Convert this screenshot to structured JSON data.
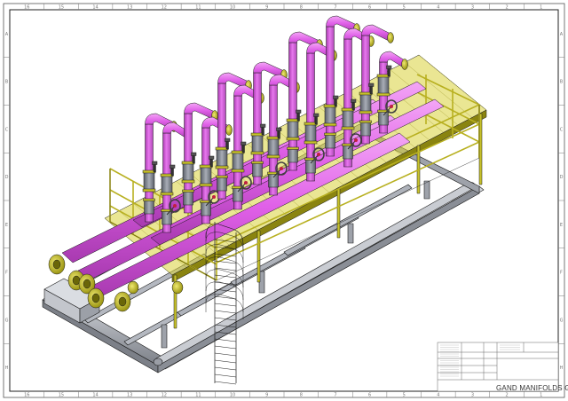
{
  "drawing": {
    "title_block": {
      "title": "GAND MANIFOLDS GOOPS"
    },
    "border": {
      "top_zones": [
        "16",
        "15",
        "14",
        "13",
        "12",
        "11",
        "10",
        "9",
        "8",
        "7",
        "6",
        "5",
        "4",
        "3",
        "2",
        "1"
      ],
      "bottom_zones": [
        "16",
        "15",
        "14",
        "13",
        "12",
        "11",
        "10",
        "9",
        "8",
        "7",
        "6",
        "5",
        "4",
        "3",
        "2",
        "1"
      ],
      "left_zones": [
        "A",
        "B",
        "C",
        "D",
        "E",
        "F",
        "G",
        "H"
      ],
      "right_zones": [
        "A",
        "B",
        "C",
        "D",
        "E",
        "F",
        "G",
        "H"
      ]
    },
    "colors": {
      "pipe": "#e060e8",
      "pipe_dark": "#a83ab0",
      "structure": "#c8c22a",
      "structure_dark": "#8a8410",
      "skid": "#b8bcc4",
      "skid_dark": "#6c7078",
      "valve": "#7a7f88",
      "handwheel": "#c02040",
      "outline": "#1a1a1a"
    }
  }
}
